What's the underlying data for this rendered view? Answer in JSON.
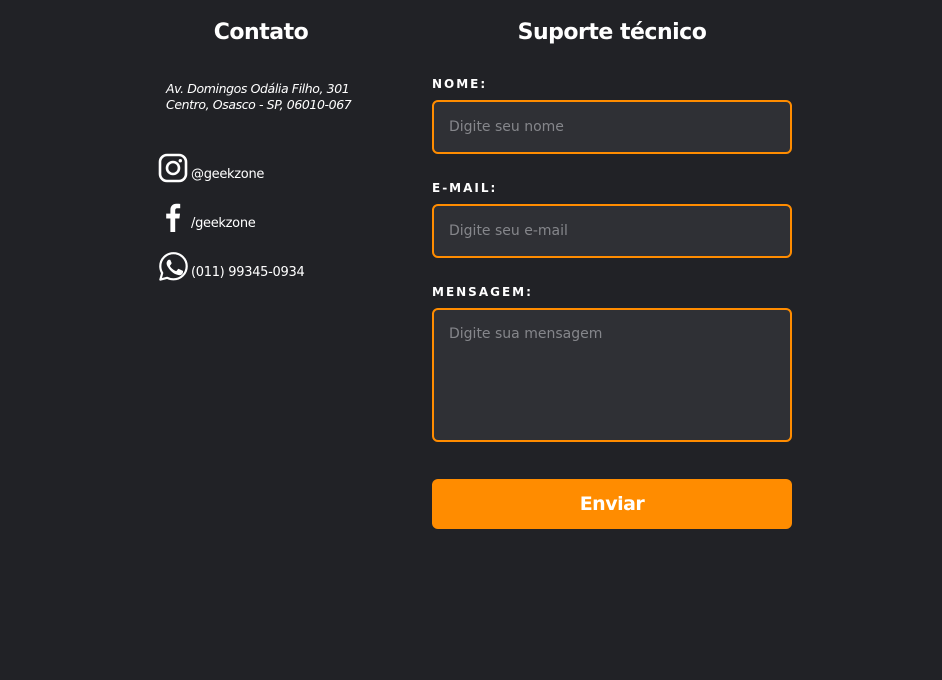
{
  "contact": {
    "title": "Contato",
    "address_line1": "Av. Domingos Odália Filho, 301",
    "address_line2": "Centro, Osasco - SP, 06010-067",
    "social": [
      {
        "icon": "instagram-icon",
        "label": "@geekzone"
      },
      {
        "icon": "facebook-icon",
        "label": "/geekzone"
      },
      {
        "icon": "whatsapp-icon",
        "label": "(011) 99345-0934"
      }
    ]
  },
  "support": {
    "title": "Suporte técnico",
    "name_label": "NOME:",
    "name_placeholder": "Digite seu nome",
    "email_label": "E-MAIL:",
    "email_placeholder": "Digite seu e-mail",
    "message_label": "MENSAGEM:",
    "message_placeholder": "Digite sua mensagem",
    "submit_label": "Enviar"
  },
  "colors": {
    "background": "#212226",
    "input_background": "#2f3035",
    "accent": "#ff8c00",
    "text": "#ffffff",
    "placeholder": "#85868b"
  }
}
